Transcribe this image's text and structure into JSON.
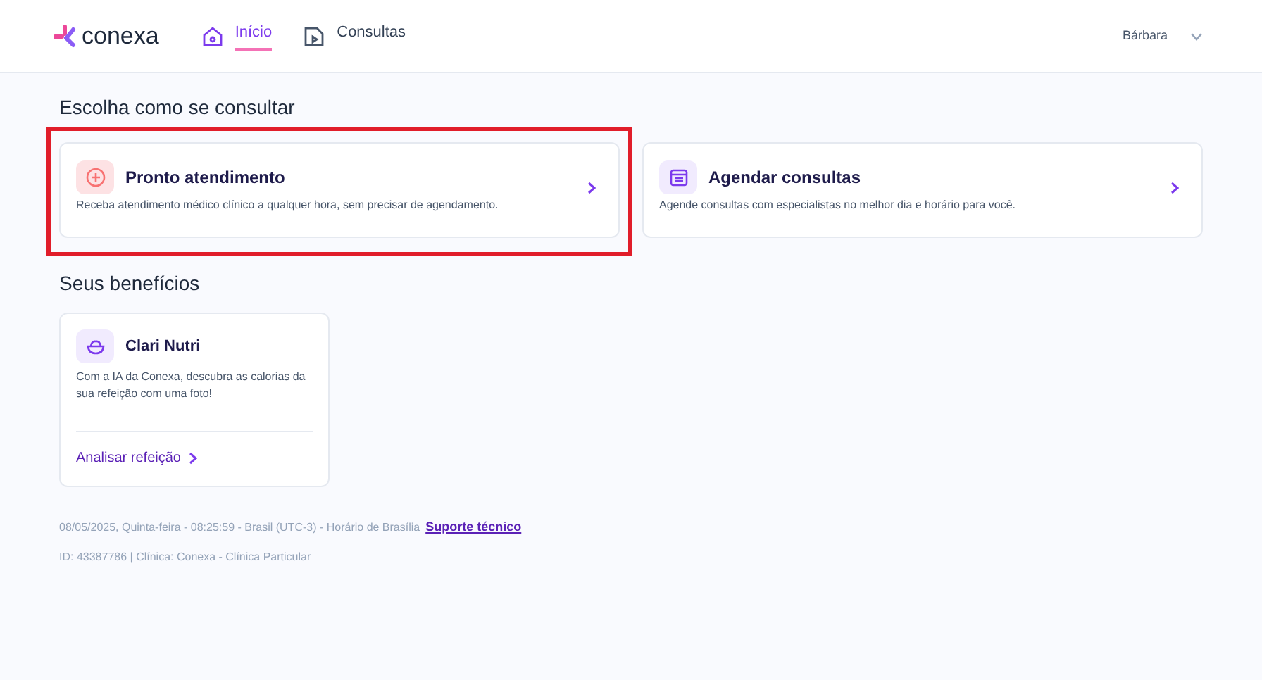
{
  "header": {
    "logo": "conexa",
    "nav": [
      {
        "label": "Início",
        "kind": "home",
        "selected": true
      },
      {
        "label": "Consultas",
        "kind": "consultations",
        "selected": false
      }
    ],
    "user": "Bárbara"
  },
  "consult_section": {
    "title": "Escolha como se consultar",
    "options": [
      {
        "title": "Pronto atendimento",
        "description": "Receba atendimento médico clínico a qualquer hora, sem precisar de agendamento.",
        "kind": "urgent",
        "highlighted": true
      },
      {
        "title": "Agendar consultas",
        "description": "Agende consultas com especialistas no melhor dia e horário para você.",
        "kind": "schedule",
        "highlighted": false
      }
    ]
  },
  "benefits_section": {
    "title": "Seus benefícios",
    "cards": [
      {
        "title": "Clari Nutri",
        "description": "Com a IA da Conexa, descubra as calorias da sua refeição com uma foto!",
        "action": "Analisar refeição"
      }
    ]
  },
  "footer": {
    "datetime": "08/05/2025, Quinta-feira - 08:25:59 - Brasil (UTC-3) - Horário de Brasília",
    "support_link": "Suporte técnico",
    "info": "ID: 43387786 | Clínica: Conexa - Clínica Particular"
  }
}
